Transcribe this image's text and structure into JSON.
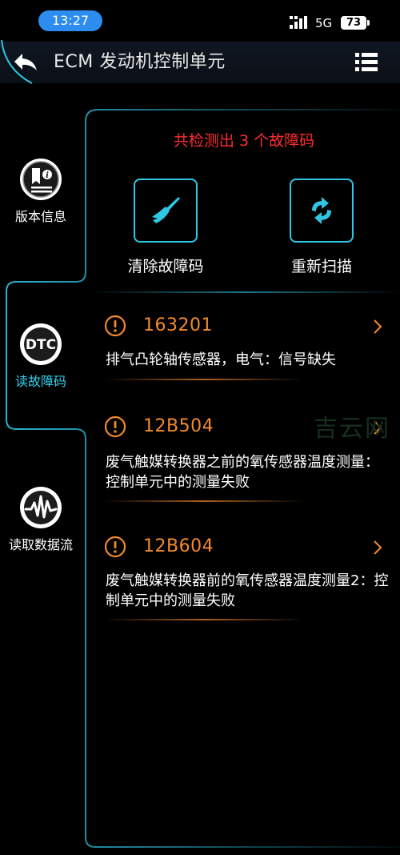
{
  "status_bar": {
    "time": "13:27",
    "network": "5G",
    "battery": "73"
  },
  "header": {
    "title": "ECM 发动机控制单元",
    "back_icon": "back-arrow-icon",
    "menu_icon": "list-menu-icon"
  },
  "sidebar": {
    "items": [
      {
        "label": "版本信息",
        "icon": "version-info-icon",
        "active": false
      },
      {
        "label": "读故障码",
        "icon": "dtc-icon",
        "icon_text": "DTC",
        "active": true
      },
      {
        "label": "读取数据流",
        "icon": "data-stream-icon",
        "active": false
      }
    ]
  },
  "main": {
    "summary": "共检测出 3 个故障码",
    "actions": [
      {
        "label": "清除故障码",
        "icon": "broom-icon"
      },
      {
        "label": "重新扫描",
        "icon": "refresh-icon"
      }
    ],
    "dtcs": [
      {
        "code": "163201",
        "description": "排气凸轮轴传感器，电气：信号缺失"
      },
      {
        "code": "12B504",
        "description": " 废气触媒转换器之前的氧传感器温度测量：控制单元中的测量失败"
      },
      {
        "code": "12B604",
        "description": " 废气触媒转换器前的氧传感器温度测量2：控制单元中的测量失败"
      }
    ]
  },
  "watermark": "吉云网",
  "colors": {
    "accent": "#2fc6e4",
    "error": "#ff2c2c",
    "code": "#f28a2e",
    "time_pill": "#2d8cf0"
  }
}
